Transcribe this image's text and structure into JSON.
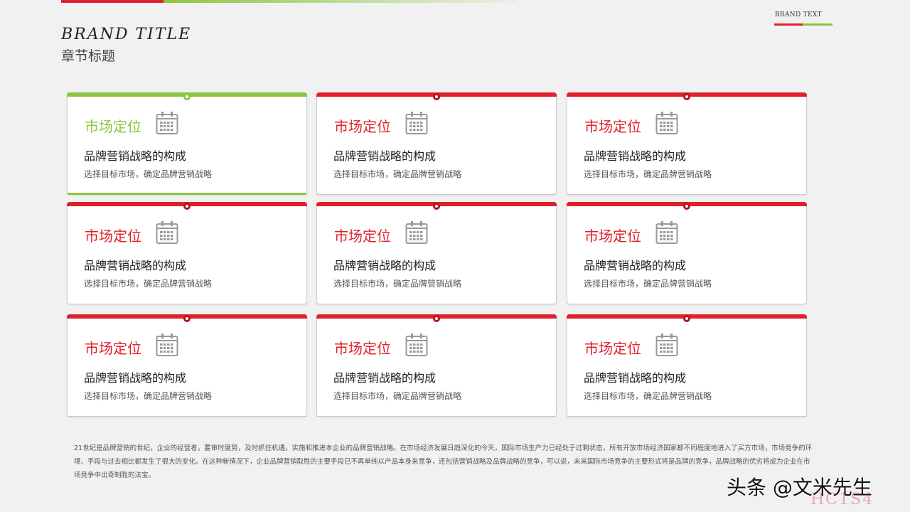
{
  "header": {
    "brand_title": "BRAND TITLE",
    "section_title": "章节标题",
    "brand_text": "BRAND TEXT"
  },
  "colors": {
    "accent_red": "#e0202a",
    "accent_green": "#8cc63f",
    "background": "#f1f1f1"
  },
  "cards": [
    {
      "title": "市场定位",
      "heading": "品牌营销战略的构成",
      "desc": "选择目标市场，确定品牌营销战略",
      "accent": "green",
      "icon": "calendar-icon"
    },
    {
      "title": "市场定位",
      "heading": "品牌营销战略的构成",
      "desc": "选择目标市场，确定品牌营销战略",
      "accent": "red",
      "icon": "calendar-icon"
    },
    {
      "title": "市场定位",
      "heading": "品牌营销战略的构成",
      "desc": "选择目标市场，确定品牌营销战略",
      "accent": "red",
      "icon": "calendar-icon"
    },
    {
      "title": "市场定位",
      "heading": "品牌营销战略的构成",
      "desc": "选择目标市场，确定品牌营销战略",
      "accent": "red",
      "icon": "calendar-icon"
    },
    {
      "title": "市场定位",
      "heading": "品牌营销战略的构成",
      "desc": "选择目标市场，确定品牌营销战略",
      "accent": "red",
      "icon": "calendar-icon"
    },
    {
      "title": "市场定位",
      "heading": "品牌营销战略的构成",
      "desc": "选择目标市场，确定品牌营销战略",
      "accent": "red",
      "icon": "calendar-icon"
    },
    {
      "title": "市场定位",
      "heading": "品牌营销战略的构成",
      "desc": "选择目标市场，确定品牌营销战略",
      "accent": "red",
      "icon": "calendar-icon"
    },
    {
      "title": "市场定位",
      "heading": "品牌营销战略的构成",
      "desc": "选择目标市场，确定品牌营销战略",
      "accent": "red",
      "icon": "calendar-icon"
    },
    {
      "title": "市场定位",
      "heading": "品牌营销战略的构成",
      "desc": "选择目标市场，确定品牌营销战略",
      "accent": "red",
      "icon": "calendar-icon"
    }
  ],
  "footer": {
    "paragraph": "21世纪是品牌营销的世纪，企业的经营者，要审时度势，及时抓住机遇，实施和推进本企业的品牌营销战略。在市场经济发展日趋深化的今天，国际市场生产力已经处于过剩状态，所有开放市场经济国家都不同程度地进入了买方市场，市场竞争的环境、手段与过去相比都发生了很大的变化。在这种新情况下，企业品牌营销取胜的主要手段已不再单纯以产品本身来竞争，还包括营销战略及品牌战略的竞争，可以说，未来国际市场竞争的主要形式将是品牌的竞争，品牌战略的优劣将成为企业在市场竞争中出奇制胜的法宝。",
    "watermark": "头条 @文米先生",
    "watermark_sub": "HC1S4"
  }
}
